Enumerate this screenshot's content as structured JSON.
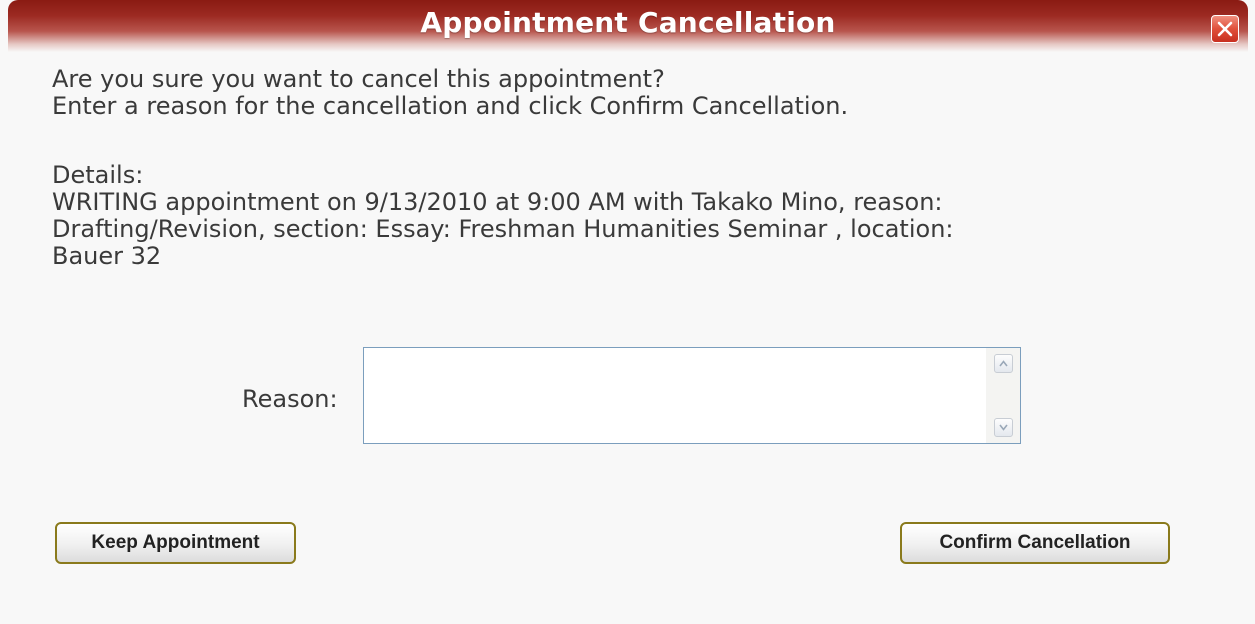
{
  "dialog": {
    "title": "Appointment Cancellation",
    "close_icon": "close-icon",
    "message_lines": [
      "Are you sure you want to cancel this appointment?",
      "Enter a reason for the cancellation and click Confirm Cancellation."
    ],
    "details_label": "Details:",
    "details_lines": [
      "WRITING appointment on 9/13/2010 at 9:00 AM with Takako Mino, reason:",
      "Drafting/Revision, section: Essay: Freshman Humanities Seminar , location:",
      "Bauer 32"
    ],
    "reason_label": "Reason:",
    "reason_value": "",
    "keep_button": "Keep Appointment",
    "confirm_button": "Confirm Cancellation"
  },
  "colors": {
    "titlebar": "#9c2a22",
    "close_button": "#e0503a",
    "button_border": "#8a7a1c",
    "text": "#3a3a3a"
  }
}
